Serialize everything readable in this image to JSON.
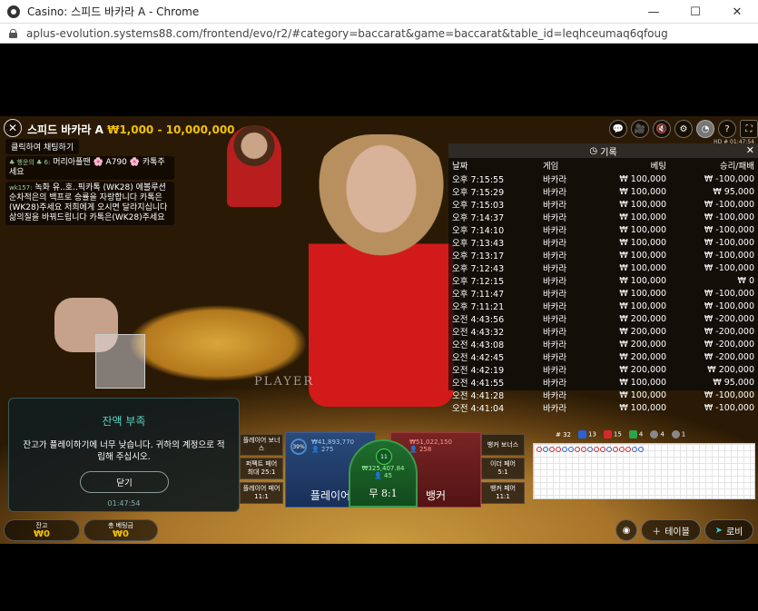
{
  "window": {
    "title": "Casino: 스피드 바카라 A - Chrome",
    "minimize": "—",
    "maximize": "☐",
    "close": "✕"
  },
  "address_bar": {
    "url": "aplus-evolution.systems88.com/frontend/evo/r2/#category=baccarat&game=baccarat&table_id=leqhceumaq6qfoug"
  },
  "game": {
    "table_name": "스피드 바카라 A",
    "limits": "₩1,000 - 10,000,000",
    "hd_info": "HD  # 01:47:54",
    "table_label": "PLAYER"
  },
  "chat": {
    "open_label": "클릭하여 채팅하기",
    "messages": [
      {
        "user": "♣ 행운의 ♣ 6:",
        "text": "머리아플땐 🌸 A790 🌸 카톡주세요"
      },
      {
        "user": "wk157:",
        "text": "녹화 유..호..픽카톡 (WK28) 에볼루션 순차적은의 백프로 승률을 자랑합니다 카톡은(WK28)주세요 저희에게 오시면 달라지십니다 삶의질을 바꿔드립니다 카톡은(WK28)주세요"
      }
    ]
  },
  "history": {
    "title": "기록",
    "close": "✕",
    "columns": [
      "날짜",
      "게임",
      "베팅",
      "승리/패배"
    ],
    "rows": [
      [
        "오후 7:15:55",
        "바카라",
        "₩ 100,000",
        "₩ -100,000"
      ],
      [
        "오후 7:15:29",
        "바카라",
        "₩ 100,000",
        "₩ 95,000"
      ],
      [
        "오후 7:15:03",
        "바카라",
        "₩ 100,000",
        "₩ -100,000"
      ],
      [
        "오후 7:14:37",
        "바카라",
        "₩ 100,000",
        "₩ -100,000"
      ],
      [
        "오후 7:14:10",
        "바카라",
        "₩ 100,000",
        "₩ -100,000"
      ],
      [
        "오후 7:13:43",
        "바카라",
        "₩ 100,000",
        "₩ -100,000"
      ],
      [
        "오후 7:13:17",
        "바카라",
        "₩ 100,000",
        "₩ -100,000"
      ],
      [
        "오후 7:12:43",
        "바카라",
        "₩ 100,000",
        "₩ -100,000"
      ],
      [
        "오후 7:12:15",
        "바카라",
        "₩ 100,000",
        "₩ 0"
      ],
      [
        "오후 7:11:47",
        "바카라",
        "₩ 100,000",
        "₩ -100,000"
      ],
      [
        "오후 7:11:21",
        "바카라",
        "₩ 100,000",
        "₩ -100,000"
      ],
      [
        "오전 4:43:56",
        "바카라",
        "₩ 200,000",
        "₩ -200,000"
      ],
      [
        "오전 4:43:32",
        "바카라",
        "₩ 200,000",
        "₩ -200,000"
      ],
      [
        "오전 4:43:08",
        "바카라",
        "₩ 200,000",
        "₩ -200,000"
      ],
      [
        "오전 4:42:45",
        "바카라",
        "₩ 200,000",
        "₩ -200,000"
      ],
      [
        "오전 4:42:19",
        "바카라",
        "₩ 200,000",
        "₩ 200,000"
      ],
      [
        "오전 4:41:55",
        "바카라",
        "₩ 100,000",
        "₩ 95,000"
      ],
      [
        "오전 4:41:28",
        "바카라",
        "₩ 100,000",
        "₩ -100,000"
      ],
      [
        "오전 4:41:04",
        "바카라",
        "₩ 100,000",
        "₩ -100,000"
      ]
    ]
  },
  "modal": {
    "title": "잔액 부족",
    "message": "잔고가 플레이하기에 너무 낮습니다. 귀하의 계정으로 적립해 주십시오.",
    "button": "닫기",
    "time": "01:47:54"
  },
  "betting": {
    "player_bonus": "플레이어 보너스",
    "perfect_pair": "퍼펙트 페어",
    "perfect_pair_odds": "최대 25:1",
    "player_pair": "플레이어 페어",
    "player_pair_odds": "11:1",
    "banker_bonus": "뱅커 보너스",
    "either_pair": "이더 페어",
    "either_pair_odds": "5:1",
    "banker_pair": "뱅커 페어",
    "banker_pair_odds": "11:1",
    "player_label": "플레이어",
    "player_amount": "₩41,893,770",
    "player_count": "275",
    "player_pct": "39%",
    "banker_label": "뱅커",
    "banker_amount": "₩51,022,150",
    "banker_count": "258",
    "tie_label": "무 8:1",
    "tie_amount": "₩325,407.84",
    "tie_count": "45",
    "tie_timer": "11"
  },
  "stats": {
    "round": "# 32",
    "player_count": "13",
    "banker_count": "15",
    "tie_count": "4",
    "ppair": "4",
    "bpair": "1",
    "player_color": "#2a62d6",
    "banker_color": "#d62a2a",
    "tie_color": "#2aa64a"
  },
  "bottom": {
    "balance_label": "잔고",
    "balance_value": "₩0",
    "total_bet_label": "총 베팅금",
    "total_bet_value": "₩0",
    "table_button": "테이블",
    "lobby_button": "로비"
  }
}
